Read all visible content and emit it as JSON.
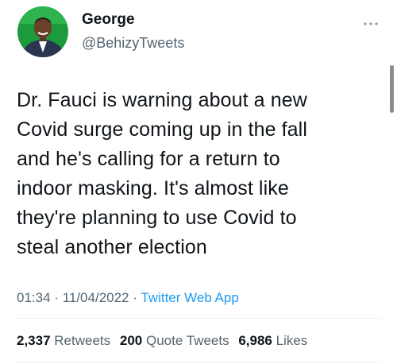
{
  "user": {
    "name": "George",
    "handle": "@BehizyTweets",
    "avatar": "profile-photo"
  },
  "tweet": {
    "text": "Dr. Fauci is warning about a new\nCovid surge coming up in the fall\nand he's calling for a return to\nindoor masking. It's almost like\nthey're planning to use Covid to\nsteal another election",
    "time": "01:34",
    "date": "11/04/2022",
    "separator": "·",
    "source": "Twitter Web App"
  },
  "stats": {
    "retweets_count": "2,337",
    "retweets_label": "Retweets",
    "quotes_count": "200",
    "quotes_label": "Quote Tweets",
    "likes_count": "6,986",
    "likes_label": "Likes"
  },
  "icons": {
    "more": "more-options-icon"
  },
  "colors": {
    "text": "#0f1419",
    "secondary": "#536471",
    "link": "#1d9bf0",
    "divider": "#eff3f4",
    "avatar_bg": "#1c9a3c"
  }
}
